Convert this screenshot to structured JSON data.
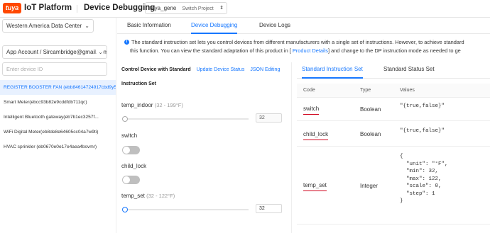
{
  "header": {
    "logo_text": "tuya",
    "platform": "IoT Platform",
    "page_title": "Device Debugging",
    "project_name": "tuya_gene",
    "project_type": "Switch Project"
  },
  "sidebar": {
    "data_center": "Western America Data Center",
    "account": "App Account / Sircambridge@gmail.com",
    "search_placeholder": "Enter device ID",
    "devices": [
      {
        "label": "REGISTER BOOSTER FAN (ebb84614724917cbd9y5)"
      },
      {
        "label": "Smart Meter(ebcc93b82e9cddfdb711qc)"
      },
      {
        "label": "Intelligent Bluetooth gateway(eb7b1ec3257f..."
      },
      {
        "label": "WiFi Digital Meter(eb8de8e64605cc04a7w9ti)"
      },
      {
        "label": "HVAC sprinkler (eb0670e0e17e4aea4bsvmr)"
      }
    ]
  },
  "tabs": [
    {
      "label": "Basic Information"
    },
    {
      "label": "Device Debugging"
    },
    {
      "label": "Device Logs"
    }
  ],
  "notice": {
    "line1": "The standard instruction set lets you control devices from different manufacturers with a single set of instructions. However, to achieve standard",
    "line2_a": "this function. You can view the standard adaptation of this product in [ ",
    "line2_link": "Product Details",
    "line2_b": "] and change to the DP instruction mode as needed to ge"
  },
  "control": {
    "title": "Control Device with Standard",
    "update_status": "Update Device Status",
    "json_editing": "JSON Editing",
    "instruction_set": "Instruction Set",
    "temp_indoor": {
      "name": "temp_indoor",
      "range": "(32 - 199°F)",
      "value": "32"
    },
    "switch": {
      "name": "switch"
    },
    "child_lock": {
      "name": "child_lock"
    },
    "temp_set": {
      "name": "temp_set",
      "range": "(32 - 122°F)",
      "value": "32"
    }
  },
  "standard": {
    "tabs": [
      {
        "label": "Standard Instruction Set"
      },
      {
        "label": "Standard Status Set"
      }
    ],
    "columns": {
      "code": "Code",
      "type": "Type",
      "values": "Values"
    },
    "rows": [
      {
        "code": "switch",
        "type": "Boolean",
        "values": "\"{true,false}\""
      },
      {
        "code": "child_lock",
        "type": "Boolean",
        "values": "\"{true,false}\""
      },
      {
        "code": "temp_set",
        "type": "Integer",
        "values": "{\n  \"unit\": \"°F\",\n  \"min\": 32,\n  \"max\": 122,\n  \"scale\": 0,\n  \"step\": 1\n}"
      }
    ]
  },
  "colors": {
    "accent": "#1677ff",
    "brand": "#ff4800",
    "underline": "#d0021b"
  }
}
